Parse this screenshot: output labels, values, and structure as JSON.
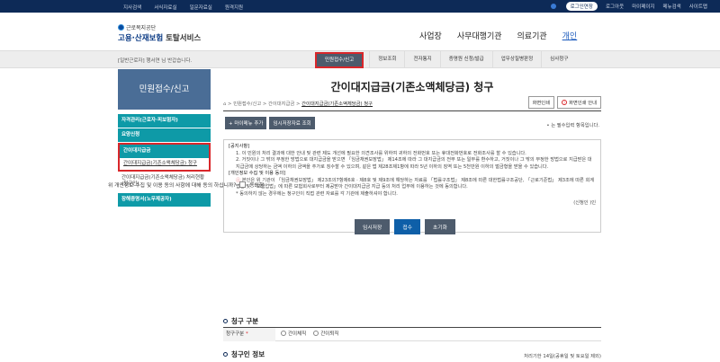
{
  "topbar": {
    "left_links": [
      "지사검색",
      "서식자료실",
      "일문자료실",
      "원격지원"
    ],
    "right_links": [
      "로그인연장",
      "로그아웃",
      "마이페이지",
      "메뉴검색",
      "사이트맵"
    ]
  },
  "header": {
    "logo_small": "근로복지공단",
    "logo_main_a": "고용·산재보험",
    "logo_main_b": " 토탈서비스",
    "gnb": [
      "사업장",
      "사무대행기관",
      "의료기관",
      "개인"
    ]
  },
  "subbar": {
    "welcome": "[일반근로자] 행서연 님 반갑습니다.",
    "tabs": [
      "민원접수/신고",
      "정보조회",
      "전자통지",
      "증명원 신청/발급",
      "업무상질병판정",
      "심사청구"
    ]
  },
  "lnb": {
    "title": "민원접수/신고",
    "items": [
      "자격관리(근로자·피보험자)",
      "요양신청",
      "간이대지급금"
    ],
    "sub1": "간이대지급금(기존소액체당금) 청구",
    "sub2": "간이대지급금(기존소액체당금) 처리현황(청구인)",
    "last_item": "장해증명서(노무제공자)"
  },
  "content": {
    "title": "간이대지급금(기존소액체당금) 청구",
    "breadcrumb": [
      "민원접수/신고",
      "간이대지급금",
      "간이대지급금(기존소액체당금) 청구"
    ],
    "btn_help": "화면인쇄",
    "btn_guide": "화면인쇄 안내",
    "tool_buttons": [
      "+ 마이메뉴 추가",
      "임시저장자료 조회"
    ],
    "required_note": "• 는 필수입력 항목입니다.",
    "notice": {
      "h1": "[공지사항]",
      "p1": "1. 이 민원의 처리 결과에 대한 안내 및 관련 제도 개선에 필요한 의견조사를 위하여 귀하의 전화번호 또는 휴대전화번호로 전화조사를 할 수 있습니다.",
      "p2": "2. 거짓이나 그 밖의 부정한 방법으로 대지급금을 받으면 「임금채권보장법」 제14조에 따라 그 대지급금의 전부 또는 일부를 환수하고, 거짓이나 그 밖의 부정한 방법으로 지급받은 대지급금에 상당하는 금액 이하의 금액을 추가로 징수할 수 있으며, 같은 법 제28조제1항에 따라 5년 이하의 징역 또는 5천만원 이하의 벌금형을 받을 수 있습니다.",
      "h2": "[개인정보 수집 및 이용 동의]",
      "p3": "본인은 위 기관이 「임금채권보장법」 제23조의7항제6호 · 제8호 및 제9조에 해당하는 자료를 「법률구조법」 제8조에 따른 대한법률구조공단, 「근로기준법」 제3조에 따른 회계법인 및 「보험업법」에 따른 보험회사로부터 제공받아 간이대지급금 지급 등의 처리 업무에 이용하는 것에 동의합니다.",
      "p4": "* 동의하지 않는 경우에는 청구인이 직접 관련 자료를 각 기관에 제출하셔야 합니다.",
      "sign": "(신청인          )인"
    },
    "agree_q": "위 개인정보 수집 및 이용 동의 사항에 대해 동의 하십니까?",
    "agree_label": "동의함",
    "actions": [
      "임시저장",
      "접수",
      "초기화"
    ],
    "section1": "청구 구분",
    "field_label": "청구구분",
    "radio_options": [
      "간이체직",
      "간이퇴직"
    ],
    "section2": "청구인 정보",
    "note2": "처리기한 14일(공휴일 및 토요일 제외)"
  }
}
